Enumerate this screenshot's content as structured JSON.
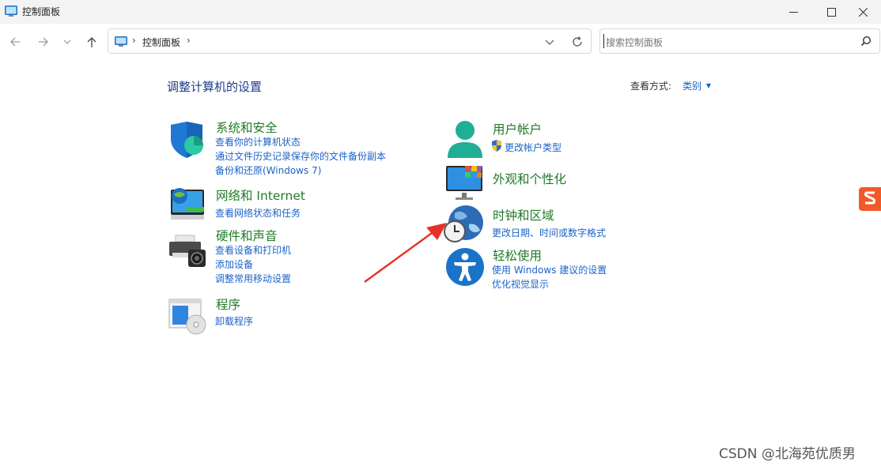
{
  "window": {
    "title": "控制面板",
    "minimize_icon": "minimize-icon",
    "maximize_icon": "maximize-icon",
    "close_icon": "close-icon"
  },
  "nav": {
    "back_icon": "back-arrow-icon",
    "forward_icon": "forward-arrow-icon",
    "recent_icon": "chevron-down-icon",
    "up_icon": "up-arrow-icon"
  },
  "address": {
    "crumb": "控制面板",
    "separator": "›"
  },
  "search": {
    "placeholder": "搜索控制面板"
  },
  "main": {
    "heading": "调整计算机的设置",
    "view_by_label": "查看方式:",
    "view_by_value": "类别"
  },
  "categories": {
    "system": {
      "title": "系统和安全",
      "links": [
        "查看你的计算机状态",
        "通过文件历史记录保存你的文件备份副本",
        "备份和还原(Windows 7)"
      ]
    },
    "network": {
      "title": "网络和 Internet",
      "links": [
        "查看网络状态和任务"
      ]
    },
    "hardware": {
      "title": "硬件和声音",
      "links": [
        "查看设备和打印机",
        "添加设备",
        "调整常用移动设置"
      ]
    },
    "programs": {
      "title": "程序",
      "links": [
        "卸载程序"
      ]
    },
    "users": {
      "title": "用户帐户",
      "links": [
        "更改帐户类型"
      ]
    },
    "appearance": {
      "title": "外观和个性化",
      "links": []
    },
    "clock": {
      "title": "时钟和区域",
      "links": [
        "更改日期、时间或数字格式"
      ]
    },
    "ease": {
      "title": "轻松使用",
      "links": [
        "使用 Windows 建议的设置",
        "优化视觉显示"
      ]
    }
  },
  "colors": {
    "category_title": "#1f7a27",
    "link": "#1a63c9",
    "heading": "#1e3a8a",
    "annotation_arrow": "#e8302a"
  },
  "watermark": "CSDN @北海苑优质男"
}
